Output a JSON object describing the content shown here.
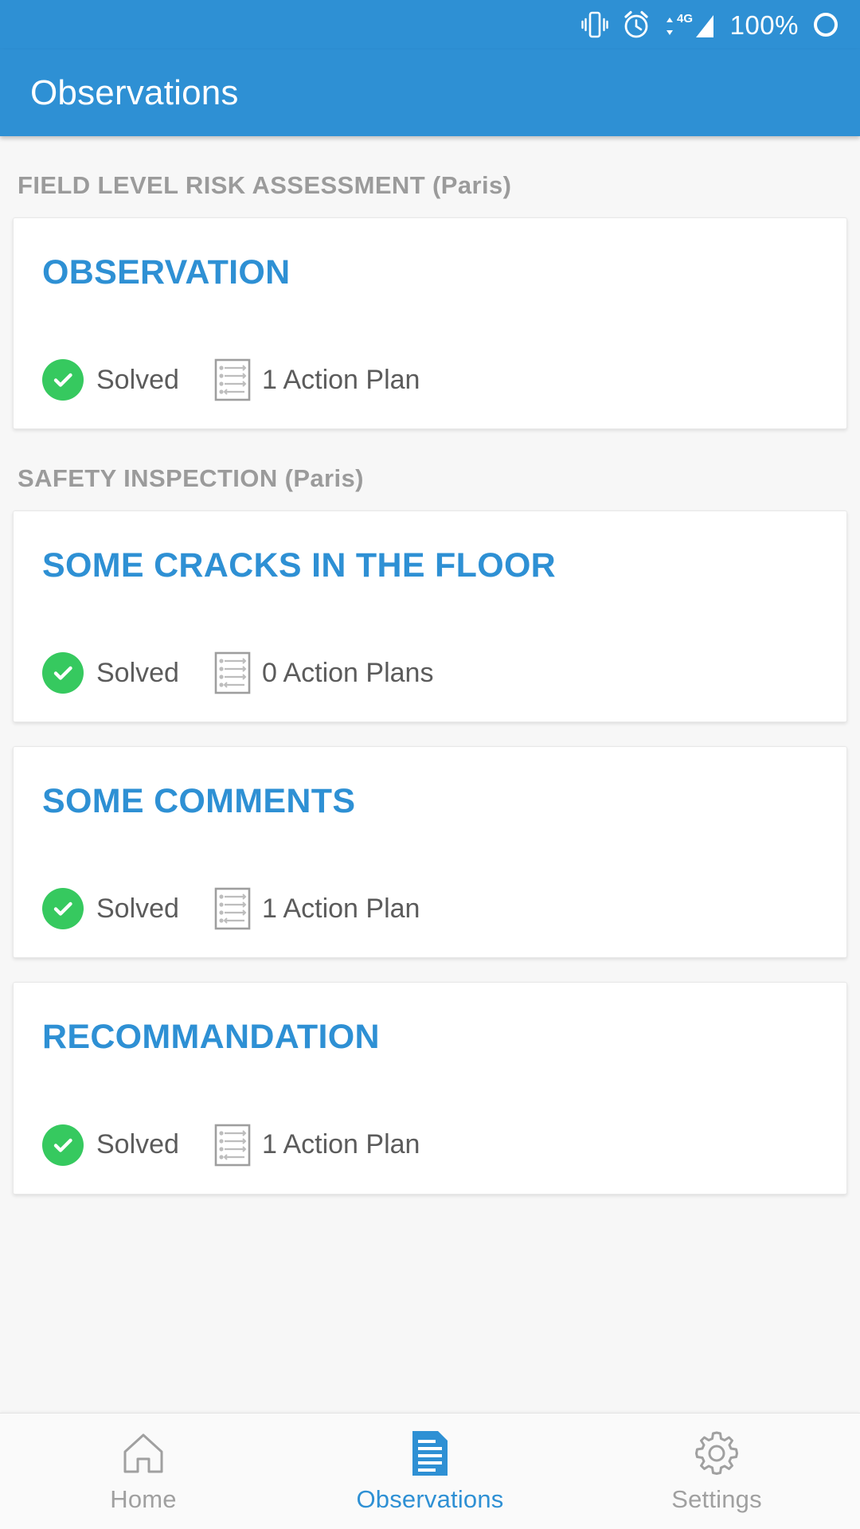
{
  "statusbar": {
    "battery_text": "100%",
    "icons": [
      "vibrate-icon",
      "alarm-clock-icon",
      "data-transfer-4g-icon",
      "signal-bars-icon",
      "battery-circle-icon"
    ],
    "network": "4G"
  },
  "appbar": {
    "title": "Observations",
    "background": "#2e90d4"
  },
  "colors": {
    "accent": "#2e90d4",
    "solved_green": "#36c95f",
    "section_header": "#9b9b9b",
    "meta_text": "#5b5b5b",
    "page_background": "#f7f7f7",
    "card_background": "#ffffff"
  },
  "sections": [
    {
      "header": "FIELD LEVEL RISK ASSESSMENT (Paris)",
      "cards": [
        {
          "title": "OBSERVATION",
          "status": "Solved",
          "plans": "1 Action Plan"
        }
      ]
    },
    {
      "header": "SAFETY INSPECTION (Paris)",
      "cards": [
        {
          "title": "SOME CRACKS IN THE FLOOR",
          "status": "Solved",
          "plans": "0 Action Plans"
        },
        {
          "title": "SOME COMMENTS",
          "status": "Solved",
          "plans": "1 Action Plan"
        },
        {
          "title": "RECOMMANDATION",
          "status": "Solved",
          "plans": "1 Action Plan"
        }
      ]
    }
  ],
  "bottomnav": {
    "items": [
      {
        "label": "Home",
        "icon": "home-icon",
        "active": false
      },
      {
        "label": "Observations",
        "icon": "document-lines-icon",
        "active": true
      },
      {
        "label": "Settings",
        "icon": "gear-icon",
        "active": false
      }
    ]
  }
}
